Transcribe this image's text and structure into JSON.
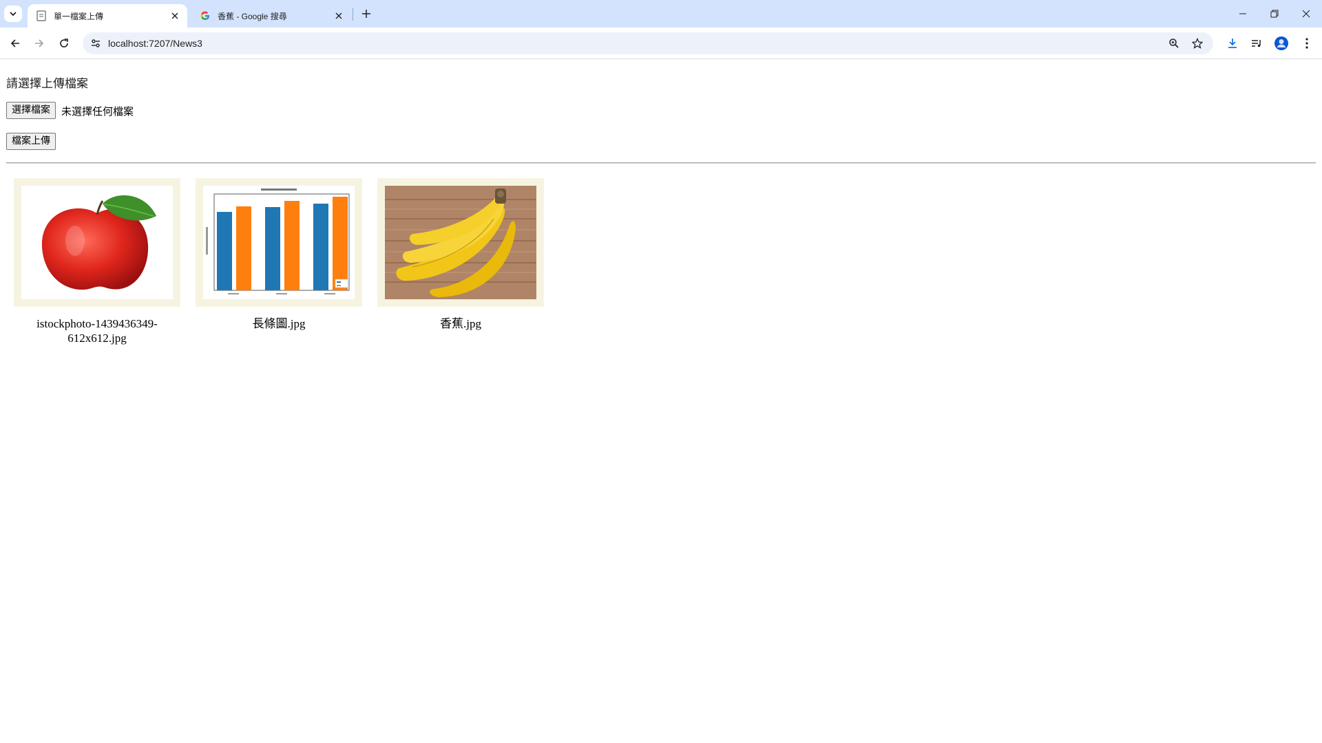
{
  "browser": {
    "tabs": [
      {
        "title": "單一檔案上傳",
        "active": true
      },
      {
        "title": "香蕉 - Google 搜尋",
        "active": false
      }
    ],
    "url": "localhost:7207/News3"
  },
  "page": {
    "heading": "請選擇上傳檔案",
    "choose_file_label": "選擇檔案",
    "file_status": "未選擇任何檔案",
    "upload_label": "檔案上傳"
  },
  "gallery": [
    {
      "caption_line1": "istockphoto-1439436349-",
      "caption_line2": "612x612.jpg",
      "image": "red apple with leaf"
    },
    {
      "caption_line1": "長條圖.jpg",
      "caption_line2": "",
      "image": "bar chart with blue and orange bars"
    },
    {
      "caption_line1": "香蕉.jpg",
      "caption_line2": "",
      "image": "bunch of bananas on wooden table"
    }
  ],
  "colors": {
    "tabstrip": "#d3e3fd",
    "frame_bg": "#f6f4e1",
    "bar_blue": "#1f77b4",
    "bar_orange": "#ff7f0e"
  }
}
